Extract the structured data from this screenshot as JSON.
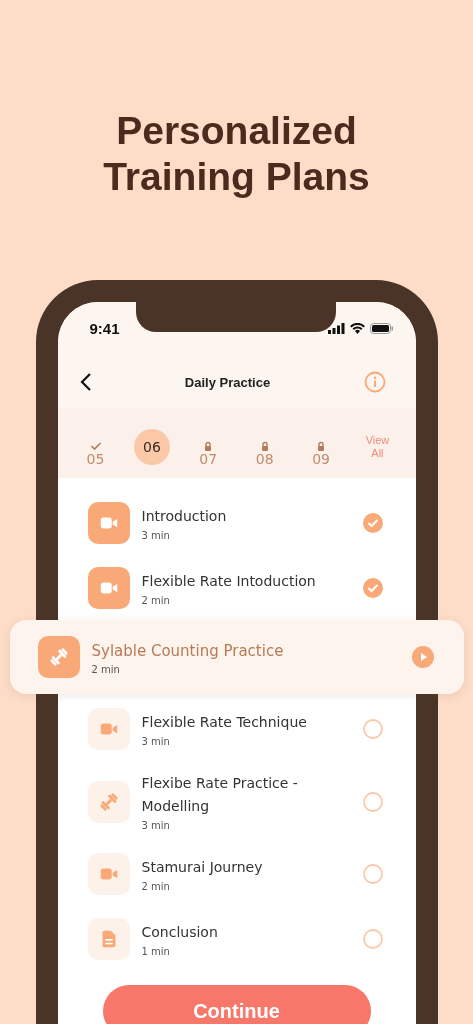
{
  "headline": "Personalized Training Plans",
  "status_bar": {
    "time": "9:41"
  },
  "nav": {
    "title": "Daily Practice"
  },
  "days": [
    {
      "label": "05",
      "done": true,
      "locked": false,
      "selected": false
    },
    {
      "label": "06",
      "done": false,
      "locked": false,
      "selected": true
    },
    {
      "label": "07",
      "done": false,
      "locked": true,
      "selected": false
    },
    {
      "label": "08",
      "done": false,
      "locked": true,
      "selected": false
    },
    {
      "label": "09",
      "done": false,
      "locked": true,
      "selected": false
    }
  ],
  "view_all": "View All",
  "items": [
    {
      "title": "Introduction",
      "duration": "3 min",
      "kind": "video",
      "done": true,
      "selected": false
    },
    {
      "title": "Flexible Rate Intoduction",
      "duration": "2 min",
      "kind": "video",
      "done": true,
      "selected": false
    },
    {
      "title": "Sylable Counting Practice",
      "duration": "2 min",
      "kind": "exercise",
      "selected": true
    },
    {
      "title": "Flexible Rate Technique",
      "duration": "3 min",
      "kind": "video",
      "done": false,
      "selected": false
    },
    {
      "title": "Flexibe Rate Practice - Modelling",
      "duration": "3 min",
      "kind": "exercise",
      "done": false,
      "selected": false
    },
    {
      "title": "Stamurai Journey",
      "duration": "2 min",
      "kind": "video",
      "done": false,
      "selected": false
    },
    {
      "title": "Conclusion",
      "duration": "1 min",
      "kind": "document",
      "done": false,
      "selected": false
    }
  ],
  "continue_button": "Continue"
}
